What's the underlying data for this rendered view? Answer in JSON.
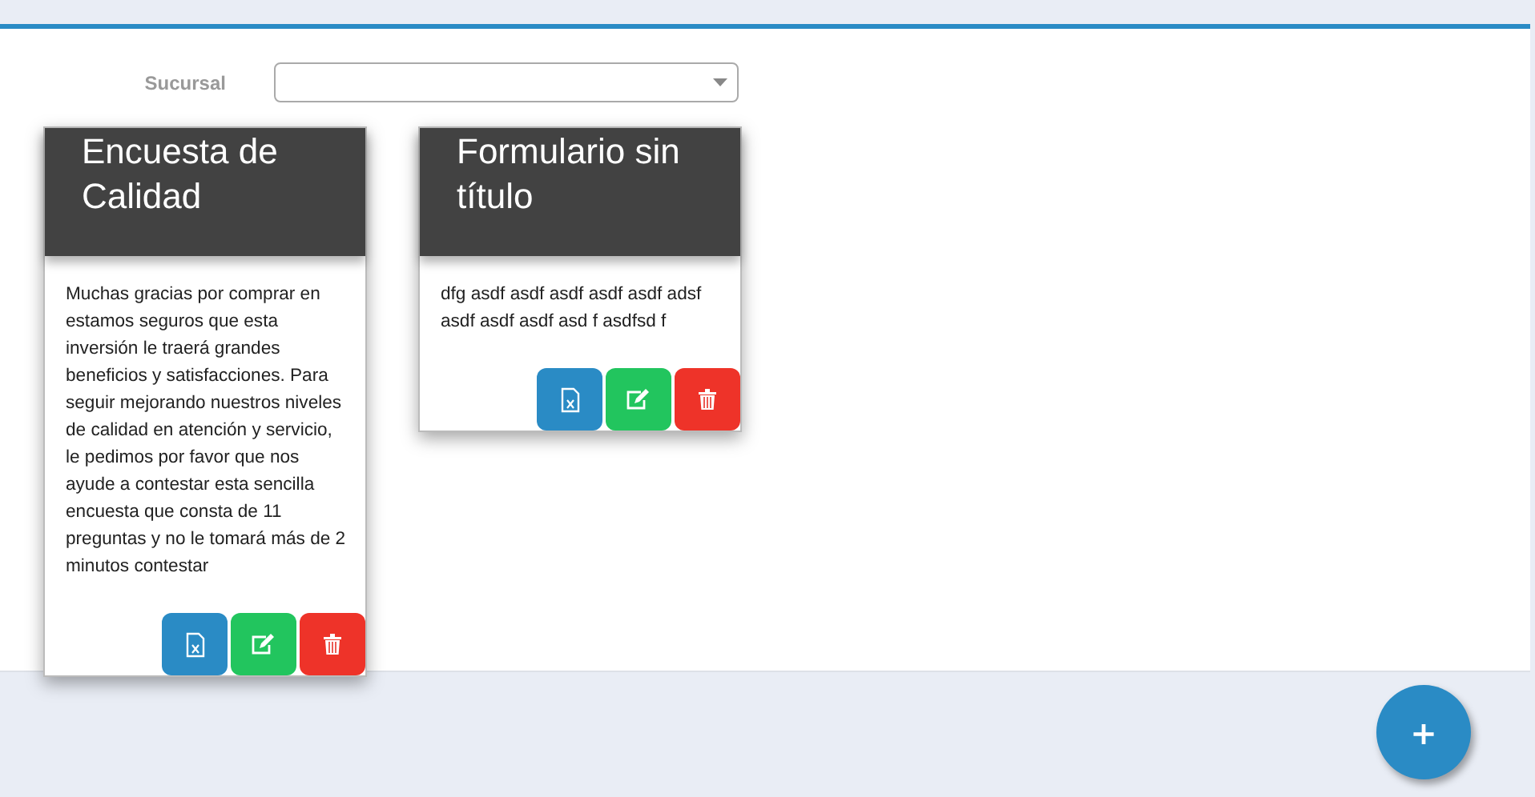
{
  "filter": {
    "label": "Sucursal"
  },
  "cards": [
    {
      "title": "Encuesta de Calidad",
      "description": "Muchas gracias por comprar en                     estamos seguros que esta inversión le traerá grandes beneficios y satisfacciones. Para seguir mejorando nuestros niveles de calidad en atención y servicio, le pedimos por favor que nos ayude a contestar esta sencilla encuesta que consta de 11 preguntas y no le tomará más de 2 minutos contestar"
    },
    {
      "title": "Formulario sin título",
      "description": "dfg asdf asdf asdf asdf asdf adsf asdf asdf asdf asd f asdfsd f"
    }
  ],
  "fab": {
    "label": "+"
  }
}
